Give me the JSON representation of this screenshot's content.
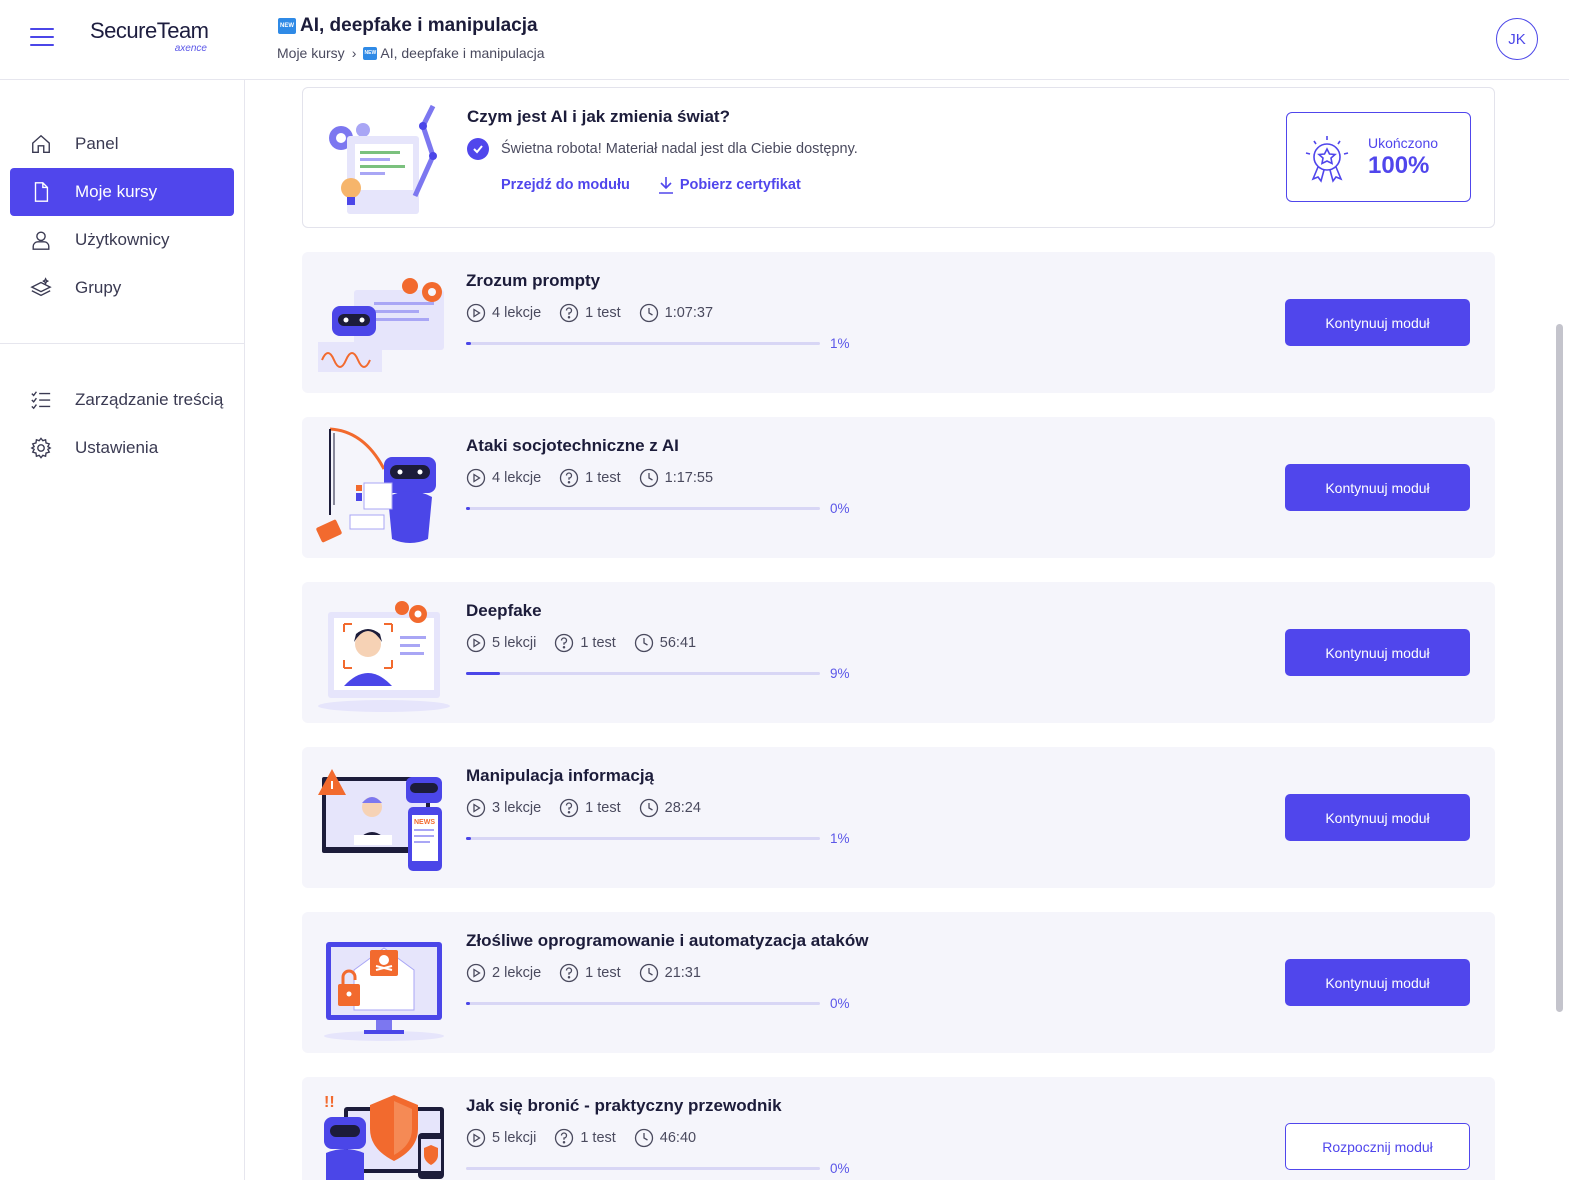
{
  "app": {
    "logo_main": "SecureTeam",
    "logo_sub": "axence",
    "menu_icon": "hamburger-icon",
    "user_initials": "JK"
  },
  "header": {
    "badge": "NEW",
    "title": "AI, deepfake i manipulacja",
    "breadcrumb": {
      "root": "Moje kursy",
      "separator": "›",
      "current": "AI, deepfake i manipulacja"
    }
  },
  "sidebar": {
    "items": [
      {
        "label": "Panel",
        "icon": "home-icon",
        "active": false
      },
      {
        "label": "Moje kursy",
        "icon": "document-icon",
        "active": true
      },
      {
        "label": "Użytkownicy",
        "icon": "user-icon",
        "active": false
      },
      {
        "label": "Grupy",
        "icon": "layers-icon",
        "active": false
      },
      {
        "label": "Zarządzanie treścią",
        "icon": "checklist-icon",
        "active": false
      },
      {
        "label": "Ustawienia",
        "icon": "gear-icon",
        "active": false
      }
    ]
  },
  "completed_module": {
    "title": "Czym jest AI i jak zmienia świat?",
    "status_text": "Świetna robota! Materiał nadal jest dla Ciebie dostępny.",
    "go_to_module": "Przejdź do modułu",
    "download_certificate": "Pobierz certyfikat",
    "completed_label": "Ukończono",
    "completed_value": "100%"
  },
  "modules": [
    {
      "title": "Zrozum prompty",
      "lessons": "4 lekcje",
      "tests": "1 test",
      "duration": "1:07:37",
      "progress_label": "1%",
      "progress": 1,
      "button": "Kontynuuj moduł",
      "button_style": "primary",
      "thumb": "robot-prompt-illustration"
    },
    {
      "title": "Ataki socjotechniczne z AI",
      "lessons": "4 lekcje",
      "tests": "1 test",
      "duration": "1:17:55",
      "progress_label": "0%",
      "progress": 0,
      "button": "Kontynuuj moduł",
      "button_style": "primary",
      "thumb": "phishing-robot-illustration"
    },
    {
      "title": "Deepfake",
      "lessons": "5 lekcji",
      "tests": "1 test",
      "duration": "56:41",
      "progress_label": "9%",
      "progress": 9,
      "button": "Kontynuuj moduł",
      "button_style": "primary",
      "thumb": "face-scan-illustration"
    },
    {
      "title": "Manipulacja informacją",
      "lessons": "3 lekcje",
      "tests": "1 test",
      "duration": "28:24",
      "progress_label": "1%",
      "progress": 1,
      "button": "Kontynuuj moduł",
      "button_style": "primary",
      "thumb": "news-robot-illustration"
    },
    {
      "title": "Złośliwe oprogramowanie i automatyzacja ataków",
      "lessons": "2 lekcje",
      "tests": "1 test",
      "duration": "21:31",
      "progress_label": "0%",
      "progress": 0,
      "button": "Kontynuuj moduł",
      "button_style": "primary",
      "thumb": "malware-monitor-illustration"
    },
    {
      "title": "Jak się bronić - praktyczny przewodnik",
      "lessons": "5 lekcji",
      "tests": "1 test",
      "duration": "46:40",
      "progress_label": "0%",
      "progress": 0,
      "button": "Rozpocznij moduł",
      "button_style": "outline",
      "thumb": "shield-robot-illustration"
    }
  ],
  "colors": {
    "accent": "#5046ec",
    "card_bg": "#f5f5fb",
    "orange": "#f26a2e"
  }
}
